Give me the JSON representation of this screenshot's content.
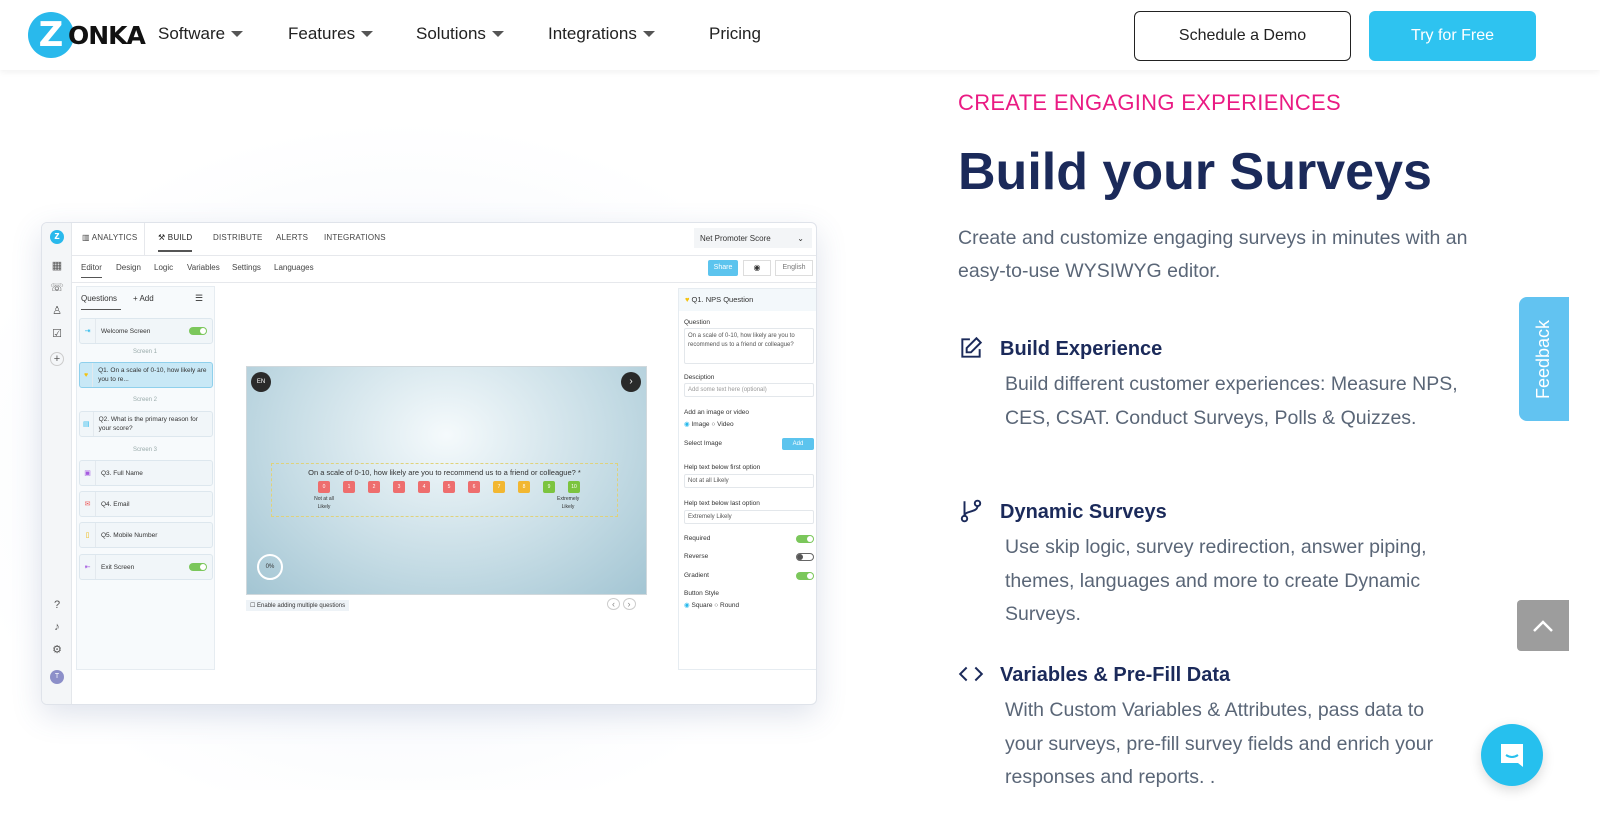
{
  "header": {
    "logo_mark": "Z",
    "logo_text": "ONKA",
    "nav": [
      {
        "label": "Software"
      },
      {
        "label": "Features"
      },
      {
        "label": "Solutions"
      },
      {
        "label": "Integrations"
      },
      {
        "label": "Pricing"
      }
    ],
    "demo_label": "Schedule a Demo",
    "try_label": "Try for Free"
  },
  "app": {
    "top_tabs": [
      "ANALYTICS",
      "BUILD",
      "DISTRIBUTE",
      "ALERTS",
      "INTEGRATIONS"
    ],
    "survey_select": "Net Promoter Score",
    "sub_tabs": [
      "Editor",
      "Design",
      "Logic",
      "Variables",
      "Settings",
      "Languages"
    ],
    "share": "Share",
    "language": "English",
    "questions_tab": "Questions",
    "add_label": "+ Add",
    "items": [
      {
        "label": "Welcome Screen"
      },
      {
        "label": "Q1. On a scale of 0-10, how likely are you to re..."
      },
      {
        "label": "Q2. What is the primary reason for your score?"
      },
      {
        "label": "Q3. Full Name"
      },
      {
        "label": "Q4. Email"
      },
      {
        "label": "Q5. Mobile Number"
      },
      {
        "label": "Exit Screen"
      }
    ],
    "screens": [
      "Screen 1",
      "Screen 2",
      "Screen 3"
    ],
    "canvas": {
      "lang": "EN",
      "question": "On a scale of 0-10, how likely are you to recommend us to a friend or colleague? *",
      "scale": [
        "0",
        "1",
        "2",
        "3",
        "4",
        "5",
        "6",
        "7",
        "8",
        "9",
        "10"
      ],
      "low_label": "Not at all Likely",
      "high_label": "Extremely Likely",
      "progress": "0%",
      "multi_label": "Enable adding multiple questions"
    },
    "panel": {
      "title": "Q1. NPS Question",
      "question_label": "Question",
      "question_value": "On a scale of 0-10, how likely are you to recommend us to a friend or colleague?",
      "desc_label": "Desciption",
      "desc_placeholder": "Add some text here (optional)",
      "media_label": "Add an image or video",
      "image": "Image",
      "video": "Video",
      "select_image": "Select Image",
      "add": "Add",
      "first_label": "Help text below first option",
      "first_value": "Not at all Likely",
      "last_label": "Help text below last option",
      "last_value": "Extremely Likely",
      "required": "Required",
      "reverse": "Reverse",
      "gradient": "Gradient",
      "style_label": "Button Style",
      "square": "Square",
      "round": "Round"
    },
    "avatar": "T"
  },
  "content": {
    "eyebrow": "CREATE ENGAGING EXPERIENCES",
    "title": "Build your Surveys",
    "description": "Create and customize engaging surveys in minutes with an easy-to-use WYSIWYG editor.",
    "features": [
      {
        "icon": "edit-icon",
        "title": "Build Experience",
        "body": "Build different customer experiences: Measure NPS, CES, CSAT. Conduct Surveys, Polls & Quizzes."
      },
      {
        "icon": "branch-icon",
        "title": "Dynamic Surveys",
        "body": "Use skip logic, survey redirection, answer piping, themes, languages and more to create Dynamic Surveys."
      },
      {
        "icon": "code-icon",
        "title": "Variables & Pre-Fill Data",
        "body": "With Custom Variables & Attributes, pass data to your surveys, pre-fill survey fields and enrich your responses and reports. ."
      }
    ]
  },
  "widgets": {
    "feedback": "Feedback"
  },
  "colors": {
    "accent": "#2ec3f0",
    "eyebrow": "#ea1a83",
    "title": "#1b2a5a"
  }
}
